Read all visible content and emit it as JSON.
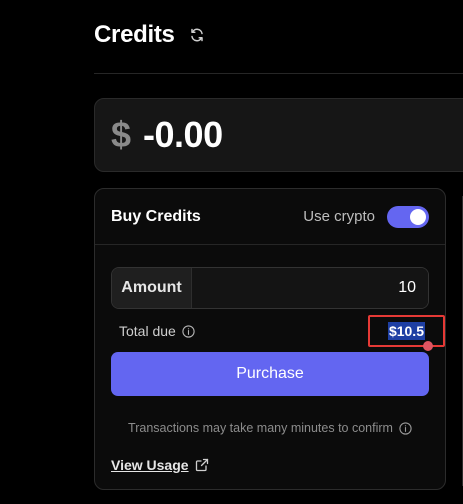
{
  "header": {
    "title": "Credits",
    "refresh_icon": "refresh-icon"
  },
  "balance": {
    "currency_symbol": "$",
    "value": "-0.00"
  },
  "buy_credits": {
    "title": "Buy Credits",
    "crypto_toggle": {
      "label": "Use crypto",
      "on": true
    },
    "amount": {
      "label": "Amount",
      "value": "10"
    },
    "total_due": {
      "label": "Total due",
      "value": "$10.5",
      "info_icon": "info-icon"
    },
    "purchase_label": "Purchase",
    "notice": "Transactions may take many minutes to confirm",
    "view_usage_label": "View Usage",
    "view_usage_icon": "external-link-icon"
  },
  "colors": {
    "accent": "#6366f1",
    "background": "#000000",
    "highlight_border": "#e53935",
    "selection": "#1e3fa3"
  }
}
